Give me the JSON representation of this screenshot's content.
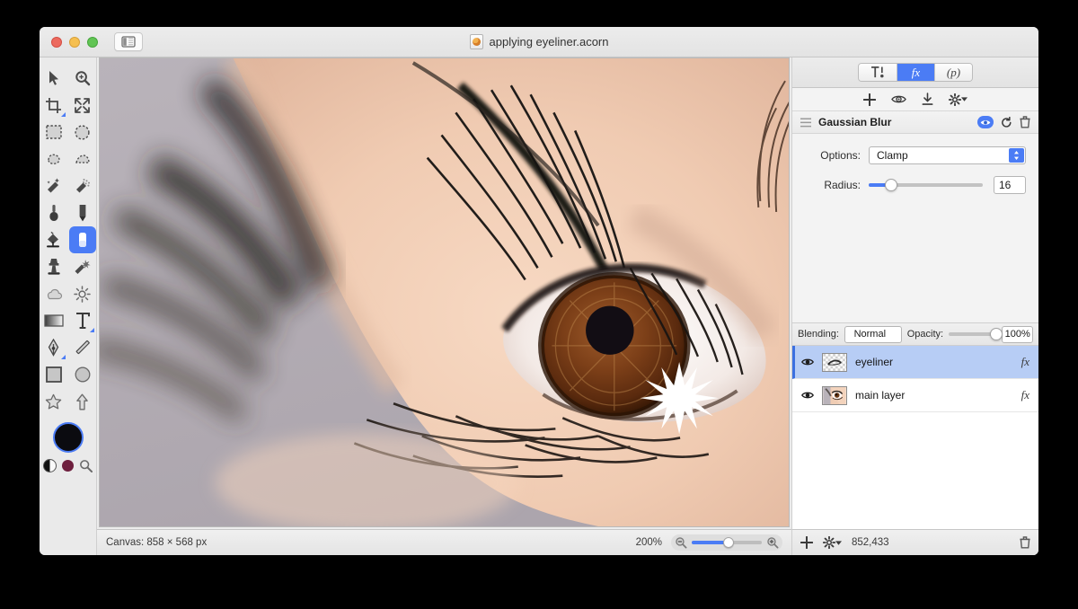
{
  "window": {
    "title": "applying eyeliner.acorn",
    "traffic_lights": [
      "close",
      "minimize",
      "zoom"
    ],
    "sidebar_toggle": "sidebar-toggle"
  },
  "accent_color": "#4b7cf5",
  "tools": {
    "rows": [
      [
        {
          "name": "arrow-select-tool",
          "sel": false,
          "sub": false
        },
        {
          "name": "zoom-tool",
          "sel": false,
          "sub": false
        }
      ],
      [
        {
          "name": "crop-tool",
          "sel": false,
          "sub": true
        },
        {
          "name": "move-tool",
          "sel": false,
          "sub": false
        }
      ],
      [
        {
          "name": "rectangular-marquee-tool",
          "sel": false,
          "sub": false
        },
        {
          "name": "elliptical-marquee-tool",
          "sel": false,
          "sub": false
        }
      ],
      [
        {
          "name": "lasso-tool",
          "sel": false,
          "sub": false
        },
        {
          "name": "polygon-lasso-tool",
          "sel": false,
          "sub": false
        }
      ],
      [
        {
          "name": "magic-wand-tool",
          "sel": false,
          "sub": false
        },
        {
          "name": "instant-alpha-tool",
          "sel": false,
          "sub": false
        }
      ],
      [
        {
          "name": "brush-tool",
          "sel": false,
          "sub": false
        },
        {
          "name": "pencil-tool",
          "sel": false,
          "sub": false
        }
      ],
      [
        {
          "name": "paint-bucket-tool",
          "sel": false,
          "sub": false
        },
        {
          "name": "eraser-tool",
          "sel": true,
          "sub": false
        }
      ],
      [
        {
          "name": "clone-stamp-tool",
          "sel": false,
          "sub": false
        },
        {
          "name": "smudge-tool",
          "sel": false,
          "sub": false
        }
      ],
      [
        {
          "name": "blur-tool",
          "sel": false,
          "sub": false
        },
        {
          "name": "dodge-burn-tool",
          "sel": false,
          "sub": false
        }
      ],
      [
        {
          "name": "gradient-tool",
          "sel": false,
          "sub": false
        },
        {
          "name": "text-tool",
          "sel": false,
          "sub": true
        }
      ],
      [
        {
          "name": "bezier-pen-tool",
          "sel": false,
          "sub": true
        },
        {
          "name": "line-tool",
          "sel": false,
          "sub": false
        }
      ],
      [
        {
          "name": "rectangle-shape-tool",
          "sel": false,
          "sub": false
        },
        {
          "name": "ellipse-shape-tool",
          "sel": false,
          "sub": false
        }
      ],
      [
        {
          "name": "star-shape-tool",
          "sel": false,
          "sub": false
        },
        {
          "name": "arrow-shape-tool",
          "sel": false,
          "sub": false
        }
      ]
    ],
    "foreground_color": "#0b0b10",
    "secondary_color": "#6e1f3e"
  },
  "panel": {
    "tabs": [
      {
        "name": "tools-tab",
        "label": ""
      },
      {
        "name": "filters-tab",
        "label": "fx",
        "active": true
      },
      {
        "name": "palette-tab",
        "label": "(p)"
      }
    ],
    "fx_toolbar": [
      "add-filter-icon",
      "preview-filter-icon",
      "download-filter-icon",
      "filter-options-gear-icon"
    ],
    "filter": {
      "name": "Gaussian Blur",
      "enabled": true,
      "options_label": "Options:",
      "options_value": "Clamp",
      "radius_label": "Radius:",
      "radius_value": "16",
      "radius_percent": 20
    }
  },
  "layers_bar": {
    "blending_label": "Blending:",
    "blending_value": "Normal",
    "opacity_label": "Opacity:",
    "opacity_value": "100%",
    "opacity_percent": 100
  },
  "layers": [
    {
      "name": "eyeliner",
      "visible": true,
      "selected": true,
      "fx": "fx",
      "thumb": "transparent-stroke"
    },
    {
      "name": "main layer",
      "visible": true,
      "selected": false,
      "fx": "fx",
      "thumb": "eye-photo"
    }
  ],
  "status": {
    "canvas_label": "Canvas: 858 × 568 px",
    "zoom_value": "200%",
    "zoom_percent": 52,
    "selection_count": "852,433"
  }
}
